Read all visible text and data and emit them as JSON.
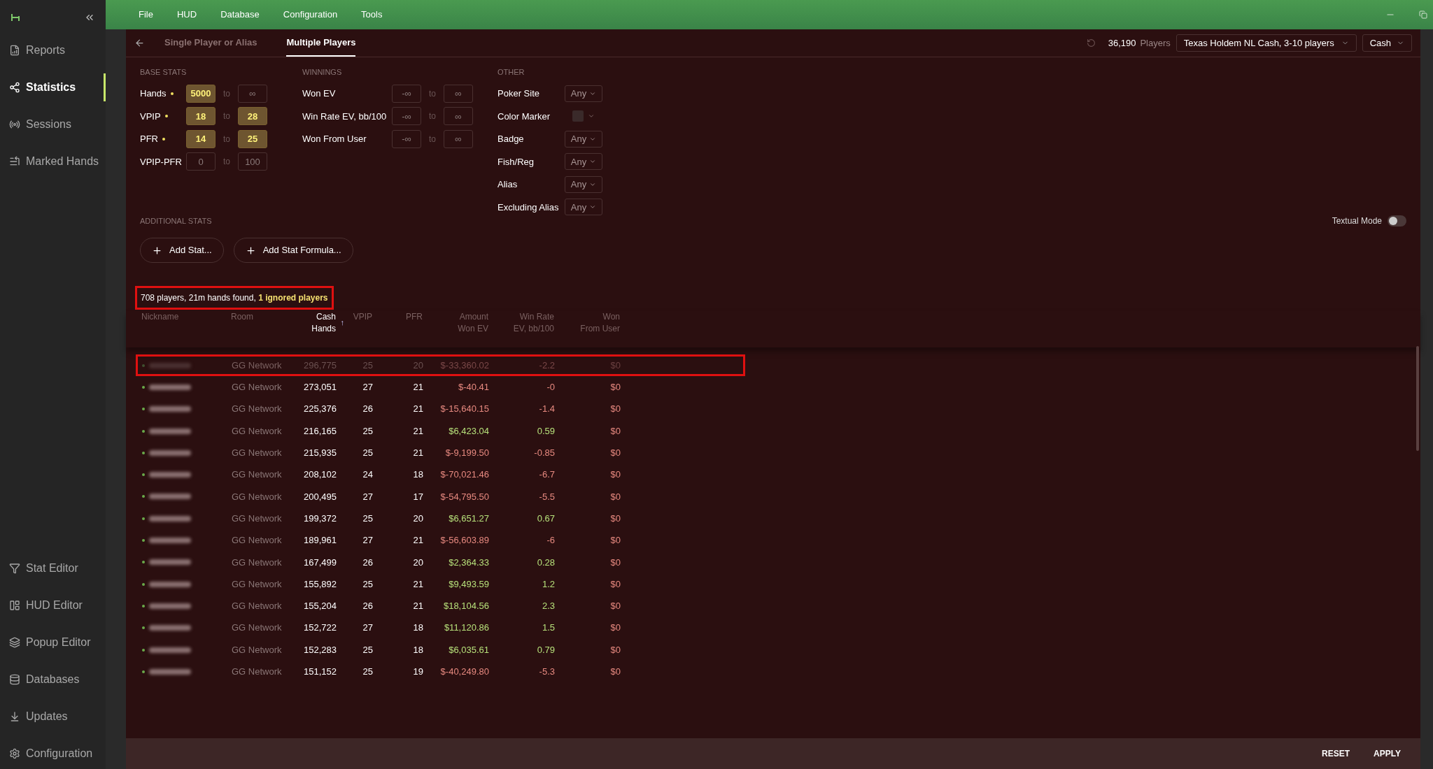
{
  "sidebar": {
    "top_items": [
      {
        "label": "Reports",
        "selected": false
      },
      {
        "label": "Statistics",
        "selected": true
      },
      {
        "label": "Sessions",
        "selected": false
      },
      {
        "label": "Marked Hands",
        "selected": false
      }
    ],
    "bottom_items": [
      {
        "label": "Stat Editor",
        "selected": false
      },
      {
        "label": "HUD Editor",
        "selected": false
      },
      {
        "label": "Popup Editor",
        "selected": false
      },
      {
        "label": "Databases",
        "selected": false
      },
      {
        "label": "Updates",
        "selected": false
      },
      {
        "label": "Configuration",
        "selected": false
      }
    ]
  },
  "menu": [
    "File",
    "HUD",
    "Database",
    "Configuration",
    "Tools"
  ],
  "tabs": [
    {
      "label": "Single Player or Alias",
      "selected": false
    },
    {
      "label": "Multiple Players",
      "selected": true
    }
  ],
  "player_count": {
    "value": "36,190",
    "label": "Players"
  },
  "game_select": "Texas Holdem NL Cash, 3-10 players",
  "mode_select": "Cash",
  "base_stats": {
    "heading": "BASE STATS",
    "rows": [
      {
        "label": "Hands",
        "active": true,
        "min": "5000",
        "min_active": true,
        "to": "to",
        "max": "∞",
        "max_active": false
      },
      {
        "label": "VPIP",
        "active": true,
        "min": "18",
        "min_active": true,
        "to": "to",
        "max": "28",
        "max_active": true
      },
      {
        "label": "PFR",
        "active": true,
        "min": "14",
        "min_active": true,
        "to": "to",
        "max": "25",
        "max_active": true
      },
      {
        "label": "VPIP-PFR",
        "active": false,
        "min": "0",
        "min_active": false,
        "to": "to",
        "max": "100",
        "max_active": false
      }
    ]
  },
  "winnings": {
    "heading": "WINNINGS",
    "rows": [
      {
        "label": "Won EV",
        "min": "-∞",
        "to": "to",
        "max": "∞"
      },
      {
        "label": "Win Rate EV, bb/100",
        "min": "-∞",
        "to": "to",
        "max": "∞"
      },
      {
        "label": "Won From User",
        "min": "-∞",
        "to": "to",
        "max": "∞"
      }
    ]
  },
  "other": {
    "heading": "OTHER",
    "rows": [
      {
        "label": "Poker Site",
        "kind": "select",
        "value": "Any"
      },
      {
        "label": "Color Marker",
        "kind": "color"
      },
      {
        "label": "Badge",
        "kind": "select",
        "value": "Any"
      },
      {
        "label": "Fish/Reg",
        "kind": "select",
        "value": "Any"
      },
      {
        "label": "Alias",
        "kind": "select",
        "value": "Any"
      },
      {
        "label": "Excluding Alias",
        "kind": "select",
        "value": "Any"
      }
    ]
  },
  "additional_stats": {
    "heading": "ADDITIONAL STATS",
    "buttons": [
      "Add Stat...",
      "Add Stat Formula..."
    ]
  },
  "textual_mode": {
    "label": "Textual Mode",
    "on": false
  },
  "summary": {
    "text": "708 players, 21m hands found, ",
    "ignored": "1 ignored players",
    "highlighted": true
  },
  "table": {
    "sort_indicator": "↑",
    "columns": [
      {
        "label": "Nickname",
        "sorted": false
      },
      {
        "label": "Room",
        "sorted": false
      },
      {
        "label": "Cash\nHands",
        "sorted": true
      },
      {
        "label": "VPIP",
        "sorted": false
      },
      {
        "label": "PFR",
        "sorted": false
      },
      {
        "label": "Amount\nWon EV",
        "sorted": false
      },
      {
        "label": "Win Rate\nEV, bb/100",
        "sorted": false
      },
      {
        "label": "Won\nFrom User",
        "sorted": false
      }
    ],
    "rows": [
      {
        "room": "GG Network",
        "hands": "296,775",
        "vpip": "25",
        "pfr": "20",
        "won": "$-33,360.02",
        "rate": "-2.2",
        "from_user": "$0",
        "positive": false,
        "ignored": true,
        "highlighted": true
      },
      {
        "room": "GG Network",
        "hands": "273,051",
        "vpip": "27",
        "pfr": "21",
        "won": "$-40.41",
        "rate": "-0",
        "from_user": "$0",
        "positive": false,
        "ignored": false,
        "highlighted": false
      },
      {
        "room": "GG Network",
        "hands": "225,376",
        "vpip": "26",
        "pfr": "21",
        "won": "$-15,640.15",
        "rate": "-1.4",
        "from_user": "$0",
        "positive": false,
        "ignored": false,
        "highlighted": false
      },
      {
        "room": "GG Network",
        "hands": "216,165",
        "vpip": "25",
        "pfr": "21",
        "won": "$6,423.04",
        "rate": "0.59",
        "from_user": "$0",
        "positive": true,
        "ignored": false,
        "highlighted": false
      },
      {
        "room": "GG Network",
        "hands": "215,935",
        "vpip": "25",
        "pfr": "21",
        "won": "$-9,199.50",
        "rate": "-0.85",
        "from_user": "$0",
        "positive": false,
        "ignored": false,
        "highlighted": false
      },
      {
        "room": "GG Network",
        "hands": "208,102",
        "vpip": "24",
        "pfr": "18",
        "won": "$-70,021.46",
        "rate": "-6.7",
        "from_user": "$0",
        "positive": false,
        "ignored": false,
        "highlighted": false
      },
      {
        "room": "GG Network",
        "hands": "200,495",
        "vpip": "27",
        "pfr": "17",
        "won": "$-54,795.50",
        "rate": "-5.5",
        "from_user": "$0",
        "positive": false,
        "ignored": false,
        "highlighted": false
      },
      {
        "room": "GG Network",
        "hands": "199,372",
        "vpip": "25",
        "pfr": "20",
        "won": "$6,651.27",
        "rate": "0.67",
        "from_user": "$0",
        "positive": true,
        "ignored": false,
        "highlighted": false
      },
      {
        "room": "GG Network",
        "hands": "189,961",
        "vpip": "27",
        "pfr": "21",
        "won": "$-56,603.89",
        "rate": "-6",
        "from_user": "$0",
        "positive": false,
        "ignored": false,
        "highlighted": false
      },
      {
        "room": "GG Network",
        "hands": "167,499",
        "vpip": "26",
        "pfr": "20",
        "won": "$2,364.33",
        "rate": "0.28",
        "from_user": "$0",
        "positive": true,
        "ignored": false,
        "highlighted": false
      },
      {
        "room": "GG Network",
        "hands": "155,892",
        "vpip": "25",
        "pfr": "21",
        "won": "$9,493.59",
        "rate": "1.2",
        "from_user": "$0",
        "positive": true,
        "ignored": false,
        "highlighted": false
      },
      {
        "room": "GG Network",
        "hands": "155,204",
        "vpip": "26",
        "pfr": "21",
        "won": "$18,104.56",
        "rate": "2.3",
        "from_user": "$0",
        "positive": true,
        "ignored": false,
        "highlighted": false
      },
      {
        "room": "GG Network",
        "hands": "152,722",
        "vpip": "27",
        "pfr": "18",
        "won": "$11,120.86",
        "rate": "1.5",
        "from_user": "$0",
        "positive": true,
        "ignored": false,
        "highlighted": false
      },
      {
        "room": "GG Network",
        "hands": "152,283",
        "vpip": "25",
        "pfr": "18",
        "won": "$6,035.61",
        "rate": "0.79",
        "from_user": "$0",
        "positive": true,
        "ignored": false,
        "highlighted": false
      },
      {
        "room": "GG Network",
        "hands": "151,152",
        "vpip": "25",
        "pfr": "19",
        "won": "$-40,249.80",
        "rate": "-5.3",
        "from_user": "$0",
        "positive": false,
        "ignored": false,
        "highlighted": false
      }
    ]
  },
  "footer_buttons": [
    "RESET",
    "APPLY"
  ]
}
